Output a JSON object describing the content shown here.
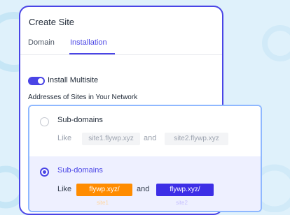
{
  "card": {
    "title": "Create Site",
    "tabs": [
      {
        "label": "Domain",
        "active": false
      },
      {
        "label": "Installation",
        "active": true
      }
    ],
    "multisite": {
      "enabled": true,
      "label": "Install Multisite"
    },
    "section_label": "Addresses of Sites in Your Network"
  },
  "options": [
    {
      "title": "Sub-domains",
      "selected": false,
      "like": "Like",
      "and": "and",
      "example_1": "site1.flywp.xyz",
      "example_2": "site2.flywp.xyz"
    },
    {
      "title": "Sub-domains",
      "selected": true,
      "like": "Like",
      "and": "and",
      "example_1": "flywp.xyz/",
      "example_2": "flywp.xyz/",
      "caption_1": "site1",
      "caption_2": "site2"
    }
  ],
  "colors": {
    "accent": "#4a45e6",
    "orange_chip": "#ff8c00",
    "purple_chip": "#3d2ee6",
    "options_border": "#8fb8ff",
    "selected_bg": "#eef0ff"
  }
}
